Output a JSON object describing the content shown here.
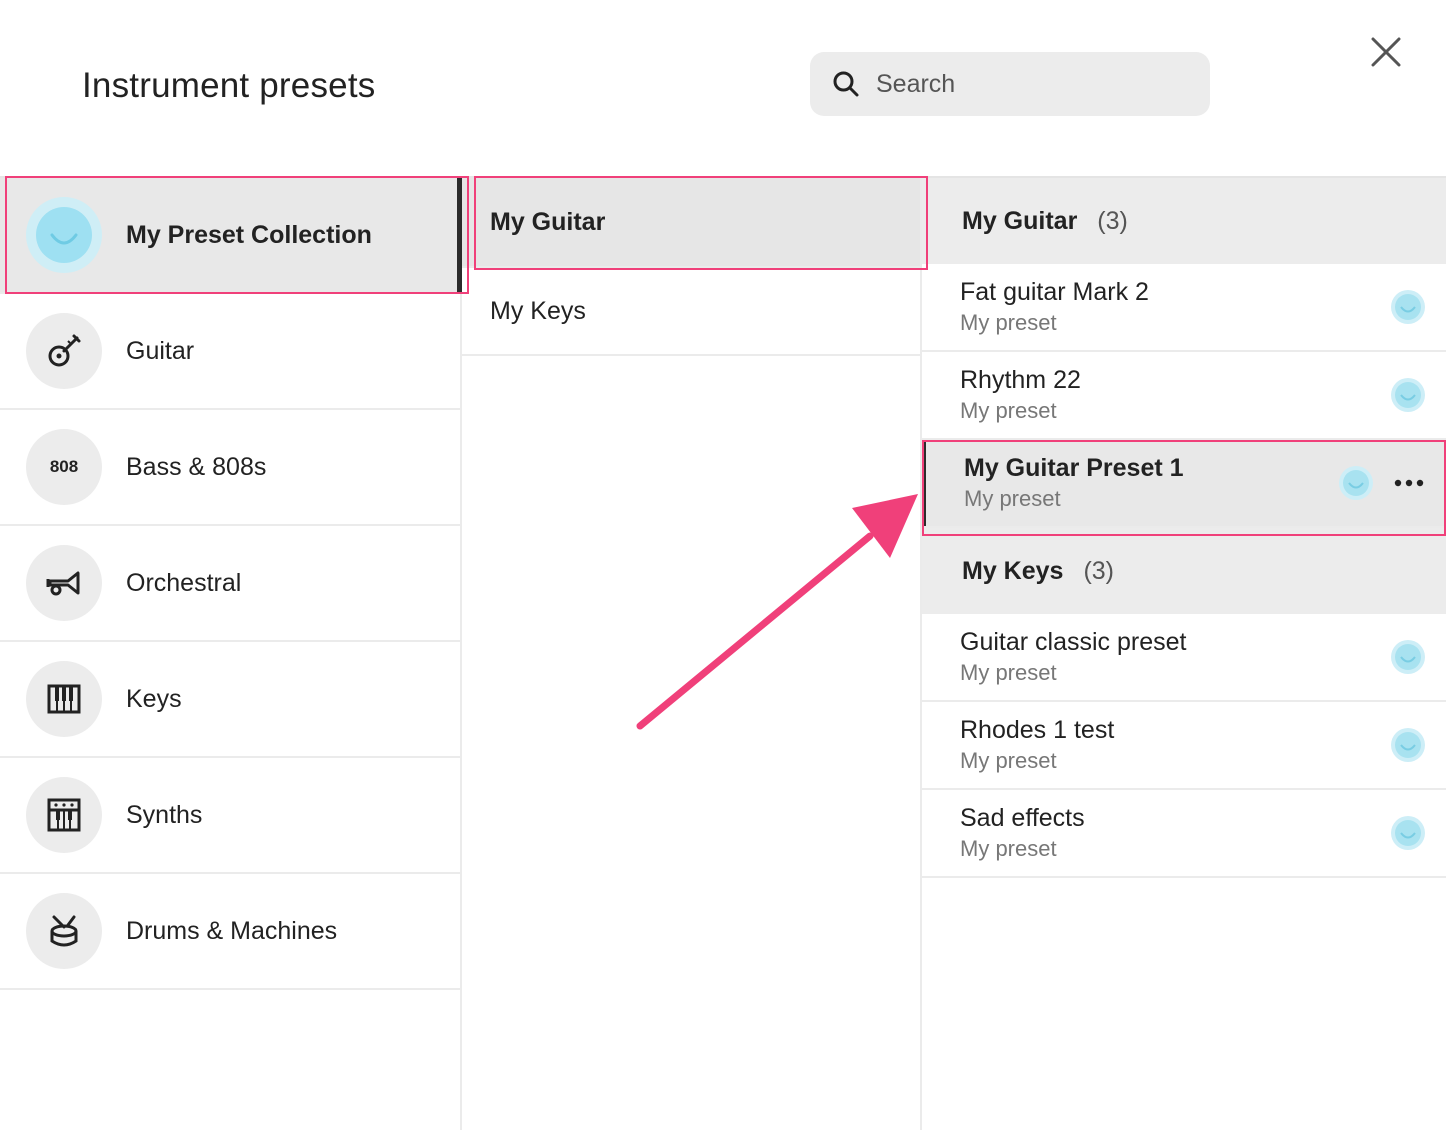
{
  "modal": {
    "title": "Instrument presets",
    "search_placeholder": "Search"
  },
  "categories": [
    {
      "label": "My Preset Collection",
      "icon": "smile-icon",
      "selected": true
    },
    {
      "label": "Guitar",
      "icon": "guitar-icon"
    },
    {
      "label": "Bass & 808s",
      "icon": "808",
      "badge": "808"
    },
    {
      "label": "Orchestral",
      "icon": "trumpet-icon"
    },
    {
      "label": "Keys",
      "icon": "keyboard-icon"
    },
    {
      "label": "Synths",
      "icon": "synth-icon"
    },
    {
      "label": "Drums & Machines",
      "icon": "drum-icon"
    }
  ],
  "subcategories": [
    {
      "label": "My Guitar",
      "selected": true
    },
    {
      "label": "My Keys"
    }
  ],
  "groups": [
    {
      "name": "My Guitar",
      "count": "(3)",
      "presets": [
        {
          "name": "Fat guitar Mark 2",
          "sub": "My preset"
        },
        {
          "name": "Rhythm 22",
          "sub": "My preset"
        },
        {
          "name": "My Guitar Preset 1",
          "sub": "My preset",
          "selected": true
        }
      ]
    },
    {
      "name": "My Keys",
      "count": "(3)",
      "presets": [
        {
          "name": "Guitar classic preset",
          "sub": "My preset"
        },
        {
          "name": "Rhodes 1 test",
          "sub": "My preset"
        },
        {
          "name": "Sad effects",
          "sub": "My preset"
        }
      ]
    }
  ],
  "colors": {
    "highlight": "#f0407a",
    "accent_dot": "#a8e2f0",
    "selected_bg": "#e8e8e8"
  }
}
